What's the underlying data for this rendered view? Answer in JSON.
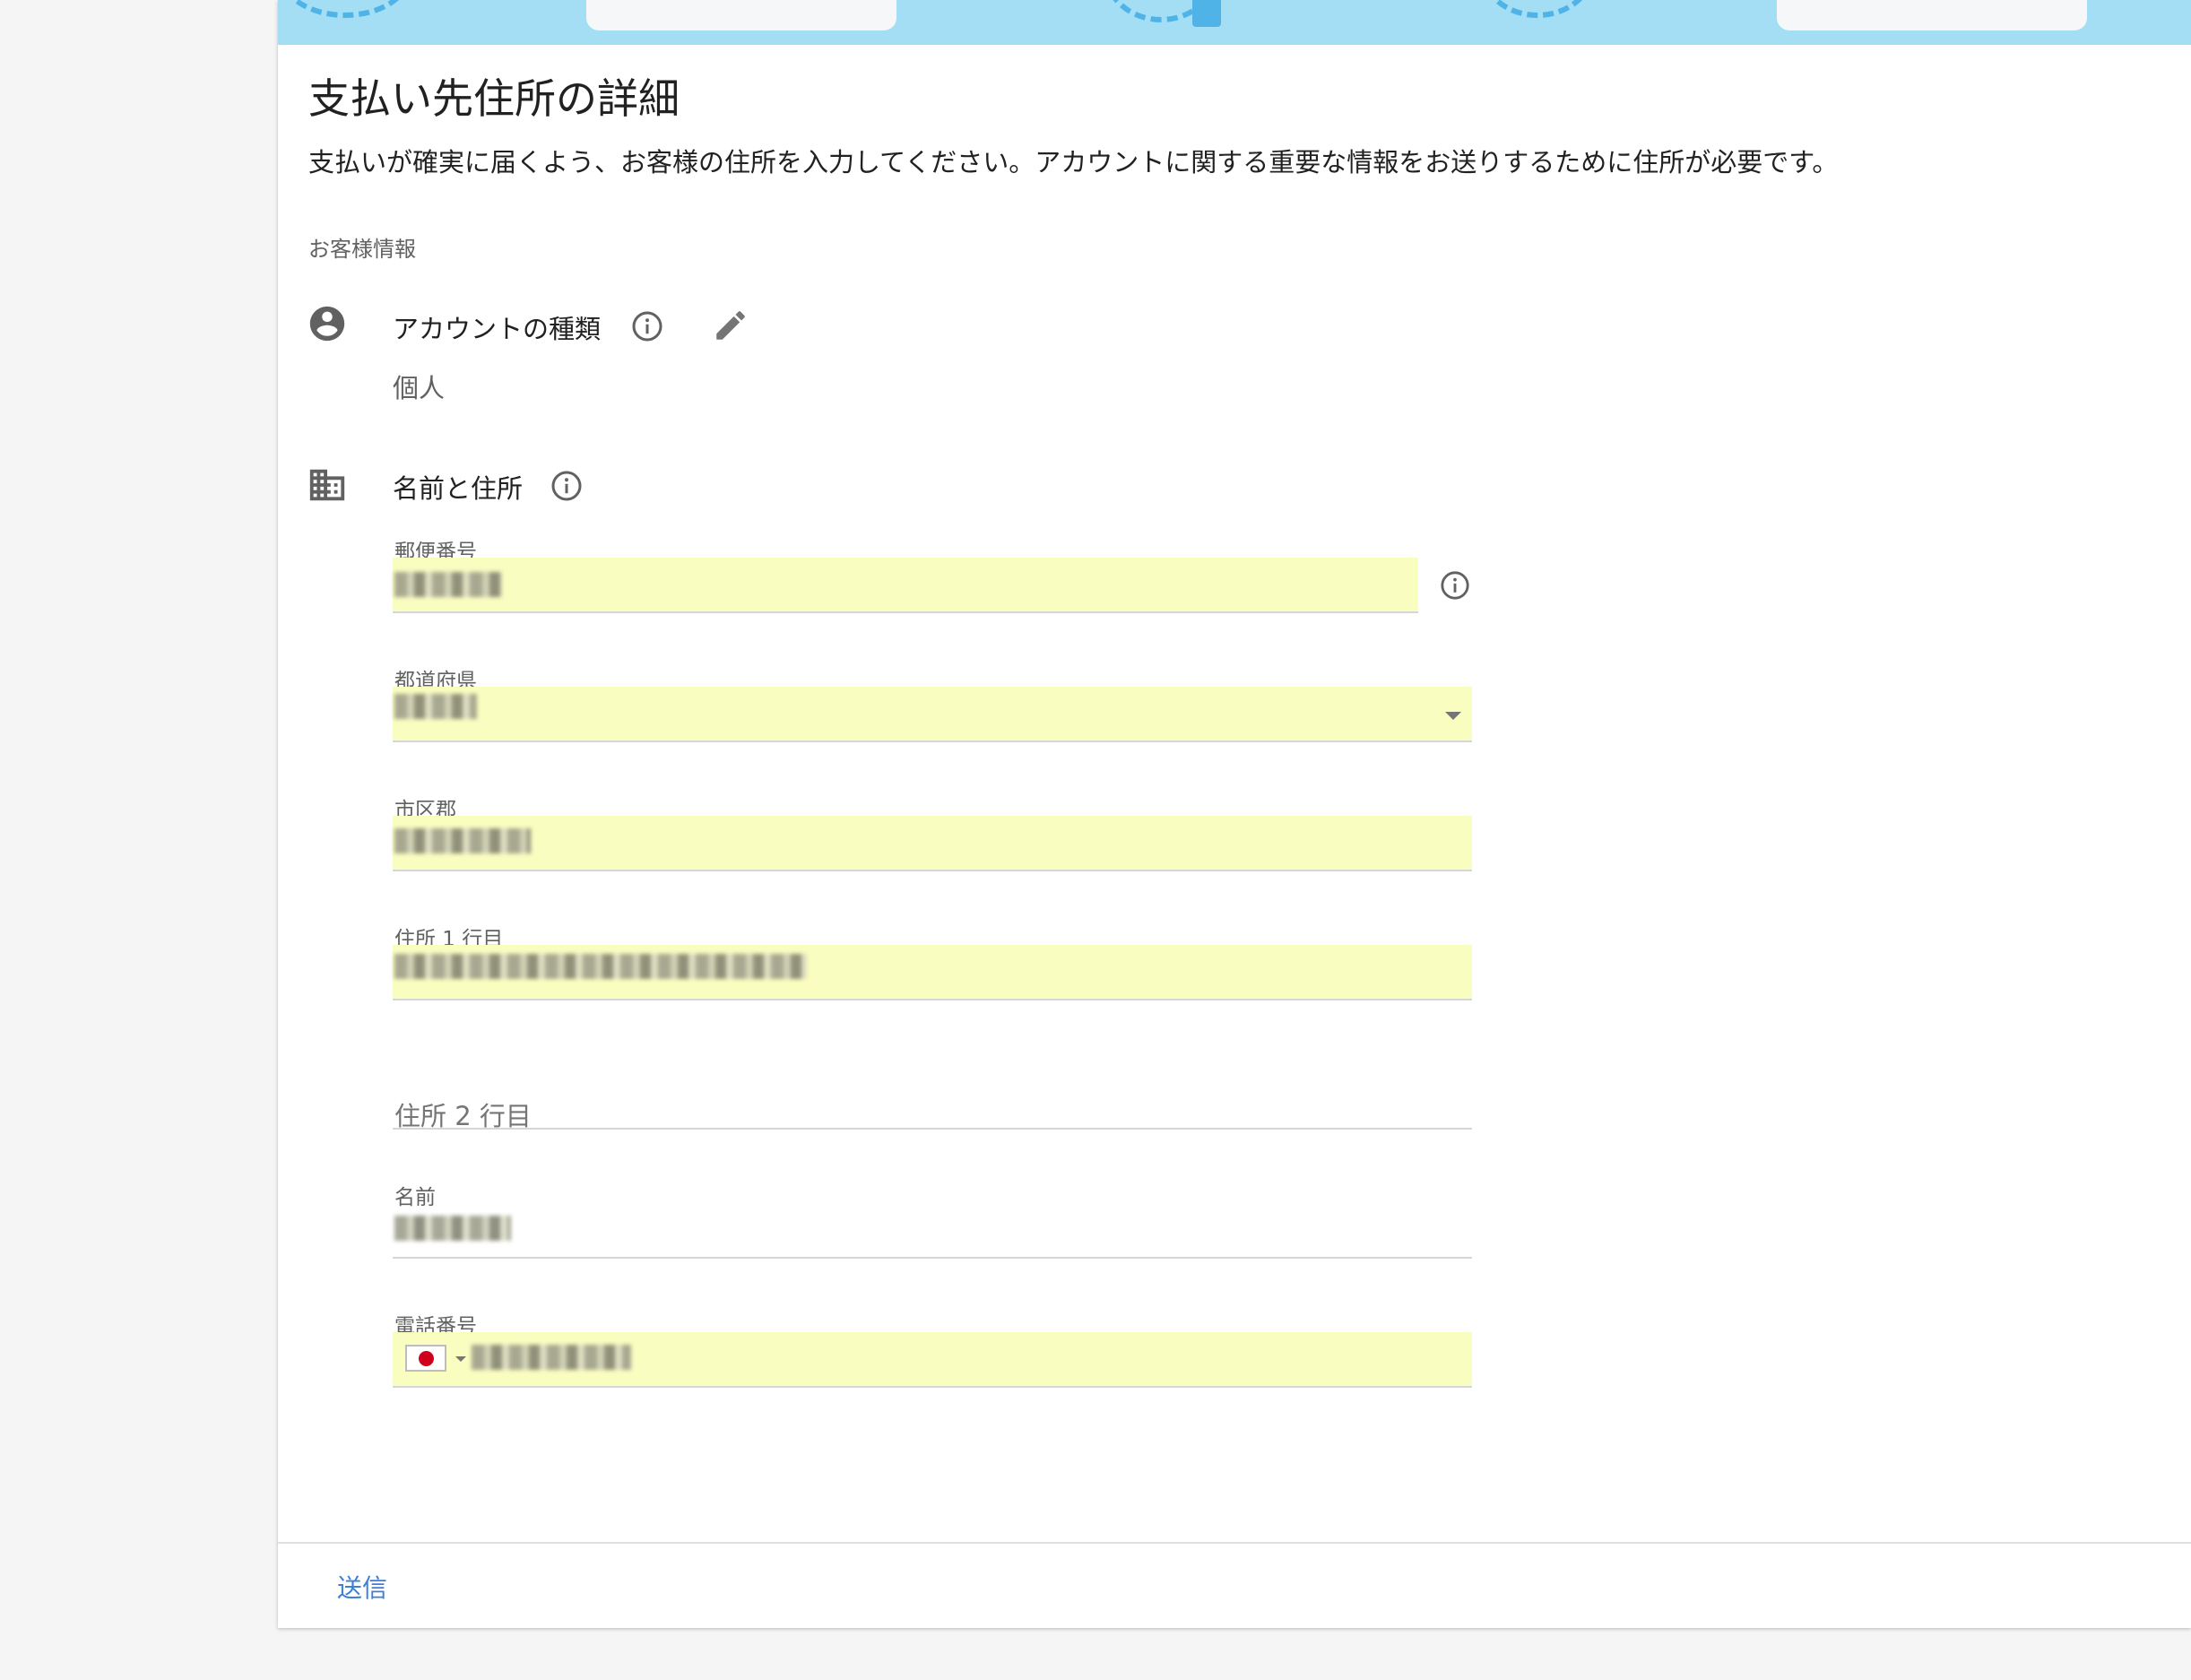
{
  "page": {
    "title": "支払い先住所の詳細",
    "subtitle": "支払いが確実に届くよう、お客様の住所を入力してください。アカウントに関する重要な情報をお送りするために住所が必要です。",
    "section_label": "お客様情報"
  },
  "account": {
    "title": "アカウントの種類",
    "value": "個人",
    "icons": {
      "row": "account-circle-icon",
      "info": "info-icon",
      "edit": "pencil-icon"
    }
  },
  "name_address": {
    "title": "名前と住所",
    "icons": {
      "row": "building-icon",
      "info": "info-icon"
    },
    "fields": {
      "postal_code": {
        "label": "郵便番号"
      },
      "prefecture": {
        "label": "都道府県"
      },
      "city": {
        "label": "市区郡"
      },
      "address1": {
        "label": "住所 1 行目"
      },
      "address2": {
        "placeholder": "住所 2 行目"
      },
      "name": {
        "label": "名前"
      },
      "phone": {
        "label": "電話番号",
        "country_flag": "japan-flag-icon"
      }
    }
  },
  "footer": {
    "submit_label": "送信"
  },
  "colors": {
    "banner": "#a3def5",
    "autofill": "#fafdc0",
    "link": "#3b7fd6"
  }
}
